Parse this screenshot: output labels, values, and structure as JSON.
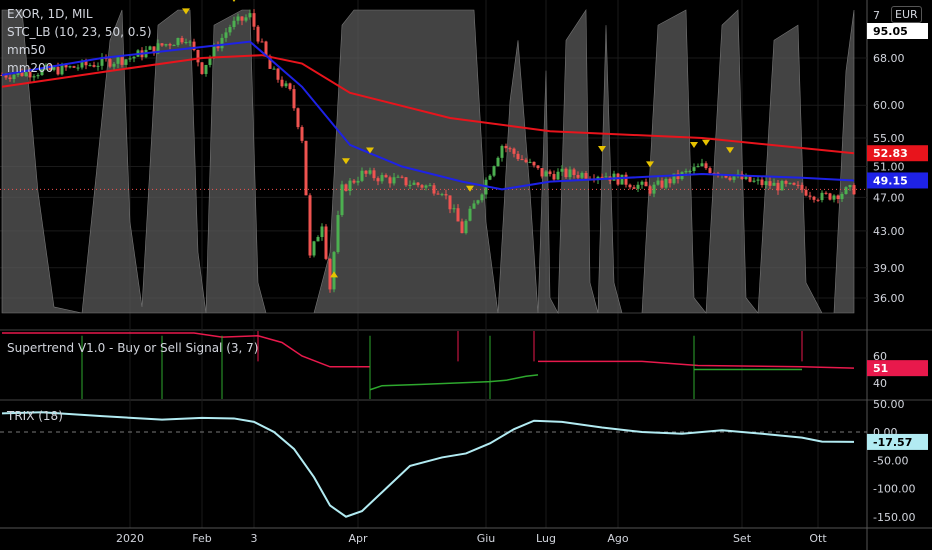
{
  "header": {
    "symbol_line": "EXOR, 1D, MIL",
    "indicator_stc": "STC_LB (10, 23, 50, 0.5)",
    "indicator_mm50": "mm50",
    "indicator_mm200": "mm200"
  },
  "currency": "EUR",
  "panes": {
    "supertrend_title": "Supertrend V1.0 - Buy or Sell Signal (3, 7)",
    "trix_title": "TRIX (18)"
  },
  "colors": {
    "up": "#26a69a",
    "upbright": "#4caf50",
    "down": "#ef5350",
    "ma50": "#1e22e6",
    "ma200": "#e8141c",
    "stc": "#5a5a5a",
    "signal": "#e6c200",
    "trix": "#b2ebf2",
    "supertrend_down": "#e8194c",
    "supertrend_up": "#2ea82e"
  },
  "chart_data": [
    {
      "type": "candlestick",
      "title": "EXOR, 1D, MIL",
      "y_ticks": [
        "68.00",
        "60.00",
        "55.00",
        "51.00",
        "47.00",
        "43.00",
        "39.00",
        "36.00"
      ],
      "y_tick_values": [
        68,
        60,
        55,
        51,
        47,
        43,
        39,
        36
      ],
      "y_top_label": "7",
      "x_ticks": [
        {
          "label": "2020",
          "bar": 32
        },
        {
          "label": "Feb",
          "bar": 50
        },
        {
          "label": "3",
          "bar": 63
        },
        {
          "label": "Apr",
          "bar": 89
        },
        {
          "label": "Giu",
          "bar": 121
        },
        {
          "label": "Lug",
          "bar": 136
        },
        {
          "label": "Ago",
          "bar": 154
        },
        {
          "label": "Set",
          "bar": 185
        },
        {
          "label": "Ott",
          "bar": 204
        }
      ],
      "price_keypoints": [
        [
          0,
          65
        ],
        [
          15,
          66
        ],
        [
          32,
          68
        ],
        [
          46,
          72
        ],
        [
          50,
          66
        ],
        [
          57,
          74
        ],
        [
          62,
          76
        ],
        [
          67,
          66
        ],
        [
          72,
          62
        ],
        [
          75,
          55
        ],
        [
          77,
          40
        ],
        [
          80,
          44
        ],
        [
          82,
          37
        ],
        [
          85,
          48
        ],
        [
          90,
          50
        ],
        [
          100,
          49
        ],
        [
          110,
          48
        ],
        [
          115,
          43
        ],
        [
          120,
          48
        ],
        [
          125,
          54
        ],
        [
          130,
          52
        ],
        [
          135,
          50
        ],
        [
          150,
          50
        ],
        [
          162,
          48
        ],
        [
          175,
          51
        ],
        [
          187,
          49
        ],
        [
          200,
          48
        ],
        [
          205,
          47
        ],
        [
          213,
          48
        ]
      ],
      "last_price": "95.05",
      "series": [
        {
          "name": "mm50",
          "last": "49.15",
          "points": [
            [
              0,
              65
            ],
            [
              25,
              68
            ],
            [
              50,
              70
            ],
            [
              62,
              71
            ],
            [
              75,
              63
            ],
            [
              87,
              54
            ],
            [
              100,
              51
            ],
            [
              115,
              49
            ],
            [
              125,
              48
            ],
            [
              137,
              49
            ],
            [
              175,
              50
            ],
            [
              200,
              49.5
            ],
            [
              213,
              49.15
            ]
          ]
        },
        {
          "name": "mm200",
          "last": "52.83",
          "points": [
            [
              0,
              63
            ],
            [
              25,
              65.5
            ],
            [
              50,
              68
            ],
            [
              65,
              68.5
            ],
            [
              75,
              67
            ],
            [
              87,
              62
            ],
            [
              112,
              58
            ],
            [
              137,
              56
            ],
            [
              175,
              55
            ],
            [
              213,
              52.83
            ]
          ]
        }
      ],
      "stc": [
        [
          0,
          100
        ],
        [
          5,
          100
        ],
        [
          9,
          40
        ],
        [
          13,
          2
        ],
        [
          20,
          0
        ],
        [
          27,
          90
        ],
        [
          30,
          100
        ],
        [
          32,
          30
        ],
        [
          35,
          2
        ],
        [
          39,
          95
        ],
        [
          44,
          100
        ],
        [
          47,
          100
        ],
        [
          49,
          20
        ],
        [
          51,
          0
        ],
        [
          53,
          95
        ],
        [
          60,
          100
        ],
        [
          62,
          100
        ],
        [
          64,
          10
        ],
        [
          66,
          0
        ],
        [
          78,
          0
        ],
        [
          82,
          20
        ],
        [
          85,
          95
        ],
        [
          88,
          100
        ],
        [
          118,
          100
        ],
        [
          121,
          30
        ],
        [
          124,
          0
        ],
        [
          127,
          70
        ],
        [
          129,
          90
        ],
        [
          132,
          40
        ],
        [
          134,
          0
        ],
        [
          136,
          80
        ],
        [
          137,
          5
        ],
        [
          139,
          0
        ],
        [
          141,
          90
        ],
        [
          146,
          100
        ],
        [
          147,
          10
        ],
        [
          149,
          0
        ],
        [
          151,
          95
        ],
        [
          153,
          10
        ],
        [
          155,
          0
        ],
        [
          160,
          0
        ],
        [
          164,
          95
        ],
        [
          171,
          100
        ],
        [
          173,
          5
        ],
        [
          176,
          0
        ],
        [
          180,
          95
        ],
        [
          184,
          100
        ],
        [
          186,
          5
        ],
        [
          189,
          0
        ],
        [
          193,
          90
        ],
        [
          199,
          95
        ],
        [
          201,
          10
        ],
        [
          205,
          0
        ],
        [
          208,
          0
        ],
        [
          211,
          80
        ],
        [
          213,
          100
        ]
      ],
      "signals": [
        [
          46,
          "down"
        ],
        [
          58,
          "down"
        ],
        [
          60,
          "down"
        ],
        [
          62,
          "down"
        ],
        [
          86,
          "down"
        ],
        [
          92,
          "down"
        ],
        [
          83,
          "up"
        ],
        [
          117,
          "down"
        ],
        [
          150,
          "down"
        ],
        [
          162,
          "down"
        ],
        [
          173,
          "down"
        ],
        [
          176,
          "down"
        ],
        [
          182,
          "down"
        ]
      ]
    },
    {
      "type": "line",
      "title": "Supertrend V1.0 - Buy or Sell Signal (3, 7)",
      "y_ticks": [
        "60",
        "40"
      ],
      "y_tick_values": [
        60,
        40
      ],
      "last": "51",
      "red": [
        [
          0,
          77
        ],
        [
          40,
          77
        ],
        [
          48,
          77
        ],
        [
          55,
          74
        ],
        [
          64,
          75
        ],
        [
          70,
          70
        ],
        [
          75,
          60
        ],
        [
          82,
          52
        ],
        [
          92,
          52
        ]
      ],
      "green": [
        [
          92,
          35
        ],
        [
          95,
          38
        ],
        [
          105,
          39
        ],
        [
          122,
          41
        ],
        [
          126,
          42
        ],
        [
          131,
          45
        ],
        [
          134,
          46
        ]
      ],
      "red2": [
        [
          134,
          56
        ],
        [
          160,
          56
        ],
        [
          174,
          53
        ],
        [
          200,
          52
        ],
        [
          213,
          51
        ]
      ],
      "green2": [
        [
          173,
          50
        ],
        [
          200,
          50
        ]
      ],
      "spikes": [
        [
          20,
          "green"
        ],
        [
          40,
          "green"
        ],
        [
          55,
          "green"
        ],
        [
          64,
          "red"
        ],
        [
          92,
          "green"
        ],
        [
          114,
          "red"
        ],
        [
          122,
          "green"
        ],
        [
          133,
          "red"
        ],
        [
          173,
          "green"
        ],
        [
          200,
          "red"
        ]
      ]
    },
    {
      "type": "line",
      "title": "TRIX (18)",
      "y_ticks": [
        "50.00",
        "0.00",
        "-50.00",
        "-100.00",
        "-150.00"
      ],
      "y_tick_values": [
        50,
        0,
        -50,
        -100,
        -150
      ],
      "last": "-17.57",
      "points": [
        [
          0,
          33
        ],
        [
          10,
          35
        ],
        [
          25,
          28
        ],
        [
          40,
          22
        ],
        [
          50,
          25
        ],
        [
          58,
          24
        ],
        [
          63,
          18
        ],
        [
          68,
          0
        ],
        [
          73,
          -30
        ],
        [
          78,
          -80
        ],
        [
          82,
          -130
        ],
        [
          86,
          -150
        ],
        [
          90,
          -140
        ],
        [
          96,
          -100
        ],
        [
          102,
          -60
        ],
        [
          110,
          -45
        ],
        [
          116,
          -38
        ],
        [
          122,
          -20
        ],
        [
          128,
          5
        ],
        [
          133,
          20
        ],
        [
          140,
          18
        ],
        [
          150,
          8
        ],
        [
          160,
          0
        ],
        [
          170,
          -3
        ],
        [
          180,
          3
        ],
        [
          190,
          -3
        ],
        [
          200,
          -10
        ],
        [
          205,
          -17
        ],
        [
          213,
          -17.57
        ]
      ]
    }
  ]
}
